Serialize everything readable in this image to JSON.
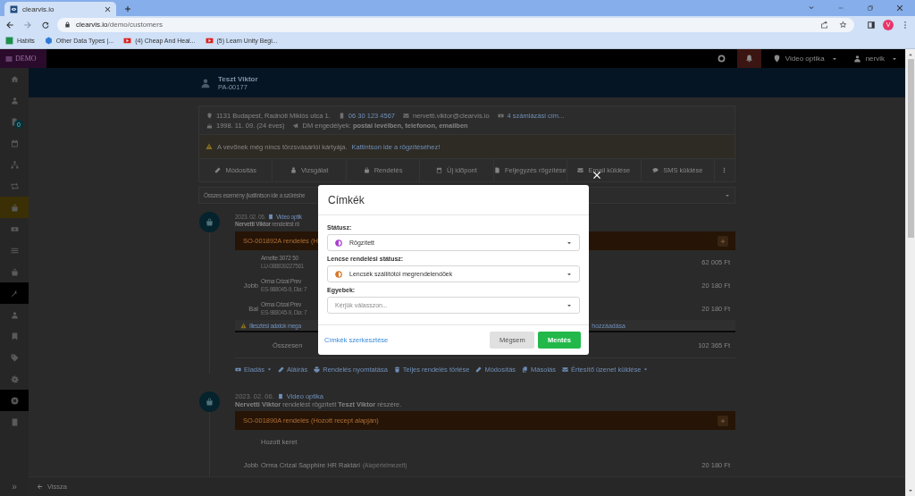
{
  "browser": {
    "tabs": [
      {
        "title": "clearvis.io",
        "selected": true
      }
    ],
    "url": {
      "host": "clearvis.io",
      "path": "/demo/customers"
    },
    "bookmarks": [
      {
        "label": "Habits"
      },
      {
        "label": "Other Data Types |..."
      },
      {
        "label": "(4) Cheap And Heal..."
      },
      {
        "label": "(5) Learn Unity Begi..."
      }
    ],
    "profile_initial": "V"
  },
  "topbar": {
    "brand": "DEMO",
    "location": "Video optika",
    "user": "nervik"
  },
  "sidebar": {
    "items": [
      {
        "selected": false,
        "highlighted": false
      },
      {
        "selected": false,
        "highlighted": false
      },
      {
        "selected": false,
        "highlighted": false,
        "badge": "0"
      },
      {
        "selected": false,
        "highlighted": false
      },
      {
        "selected": false,
        "highlighted": false
      },
      {
        "selected": false,
        "highlighted": false
      },
      {
        "selected": true,
        "highlighted": false
      },
      {
        "selected": false,
        "highlighted": false
      },
      {
        "selected": false,
        "highlighted": false
      },
      {
        "selected": false,
        "highlighted": false
      },
      {
        "selected": false,
        "highlighted": true
      },
      {
        "selected": false,
        "highlighted": false
      },
      {
        "selected": false,
        "highlighted": false
      },
      {
        "selected": false,
        "highlighted": false
      },
      {
        "selected": false,
        "highlighted": false
      },
      {
        "selected": false,
        "highlighted": true
      },
      {
        "selected": false,
        "highlighted": false
      }
    ],
    "collapse": "»"
  },
  "customer": {
    "name": "Teszt Viktor",
    "code": "PA-00177",
    "address": "1131 Budapest, Radnóti Miklós utca 1.",
    "phone": "06 30 123 4567",
    "email": "nervetti.viktor@clearvis.io",
    "billing": "4 számlázási cím...",
    "birth": "1998. 11. 09. (24 éves)",
    "dm": "DM engedélyek: **postai levélben, telefonon, emailben**",
    "notice": {
      "text": "A vevőnek még nincs törzsvásárlói kártyája.",
      "link": "Kattintson ide a rögzítéséhez!"
    },
    "actions": [
      {
        "label": "Módosítás"
      },
      {
        "label": "Vizsgálat"
      },
      {
        "label": "Rendelés"
      },
      {
        "label": "Új időpont"
      },
      {
        "label": "Feljegyzés rögzítése"
      },
      {
        "label": "Email küldése"
      },
      {
        "label": "SMS küldése"
      }
    ]
  },
  "filter": {
    "value": "Összes esemény (kattintson ide a szűréshe"
  },
  "events": [
    {
      "date": "2023. 02. 06.",
      "location": "Video optik",
      "summary": "**Nervetti Viktor** rendelést rö",
      "order": {
        "title": "SO-001892A rendelés (H",
        "lines": [
          {
            "name": "Arnette 3072 50",
            "code": "LU-088839227561",
            "price": "62 005 Ft"
          },
          {
            "side": "Jobb",
            "name": "Orma Crizal Prev",
            "code": "ES-988045-9, Dia: 7",
            "price": "20 180 Ft"
          },
          {
            "side": "Bal",
            "name": "Orma Crizal Prev",
            "code": "ES-988045-9, Dia: 7",
            "price": "20 180 Ft"
          }
        ],
        "warning": {
          "text": "Illesztési adatok mega",
          "tail": "hozzáadása"
        },
        "total": {
          "label": "Összesen",
          "value": "102 365 Ft"
        }
      },
      "links": [
        {
          "label": "Eladás",
          "dropdown": true
        },
        {
          "label": "Aláírás",
          "dropdown": false
        },
        {
          "label": "Rendelés nyomtatása",
          "dropdown": false
        },
        {
          "label": "Teljes rendelés törlése",
          "dropdown": false
        },
        {
          "label": "Módosítás",
          "dropdown": false
        },
        {
          "label": "Másolás",
          "dropdown": false
        },
        {
          "label": "Értesítő üzenet küldése",
          "dropdown": true
        }
      ]
    },
    {
      "date": "2023. 02. 06.",
      "location": "Video optika",
      "summary": "**Nervetti Viktor** rendelést rögzített **Teszt Viktor** részére.",
      "order": {
        "title": "SO-001890A rendelés (Hozott recept alapján)",
        "lines": [
          {
            "name": "Hozott keret"
          },
          {
            "side": "Jobb",
            "name": "Orma Crizal Sapphire HR Raktári",
            "note": "(Alapértelmezett)",
            "price": "20 180 Ft"
          }
        ]
      }
    }
  ],
  "bottom": {
    "back": "Vissza"
  },
  "modal": {
    "title": "Címkék",
    "fields": [
      {
        "label": "Státusz:",
        "value": "Rögzített",
        "color": "#a93fd0"
      },
      {
        "label": "Lencse rendelési státusz:",
        "value": "Lencsék szállítótól megrendelendőek",
        "color": "#d7792a"
      },
      {
        "label": "Egyebek:",
        "placeholder": "Kérjük válasszon..."
      }
    ],
    "edit_link": "Címkék szerkesztése",
    "buttons": [
      {
        "label": "Mégsem",
        "kind": "secondary"
      },
      {
        "label": "Mentés",
        "kind": "primary"
      }
    ]
  }
}
